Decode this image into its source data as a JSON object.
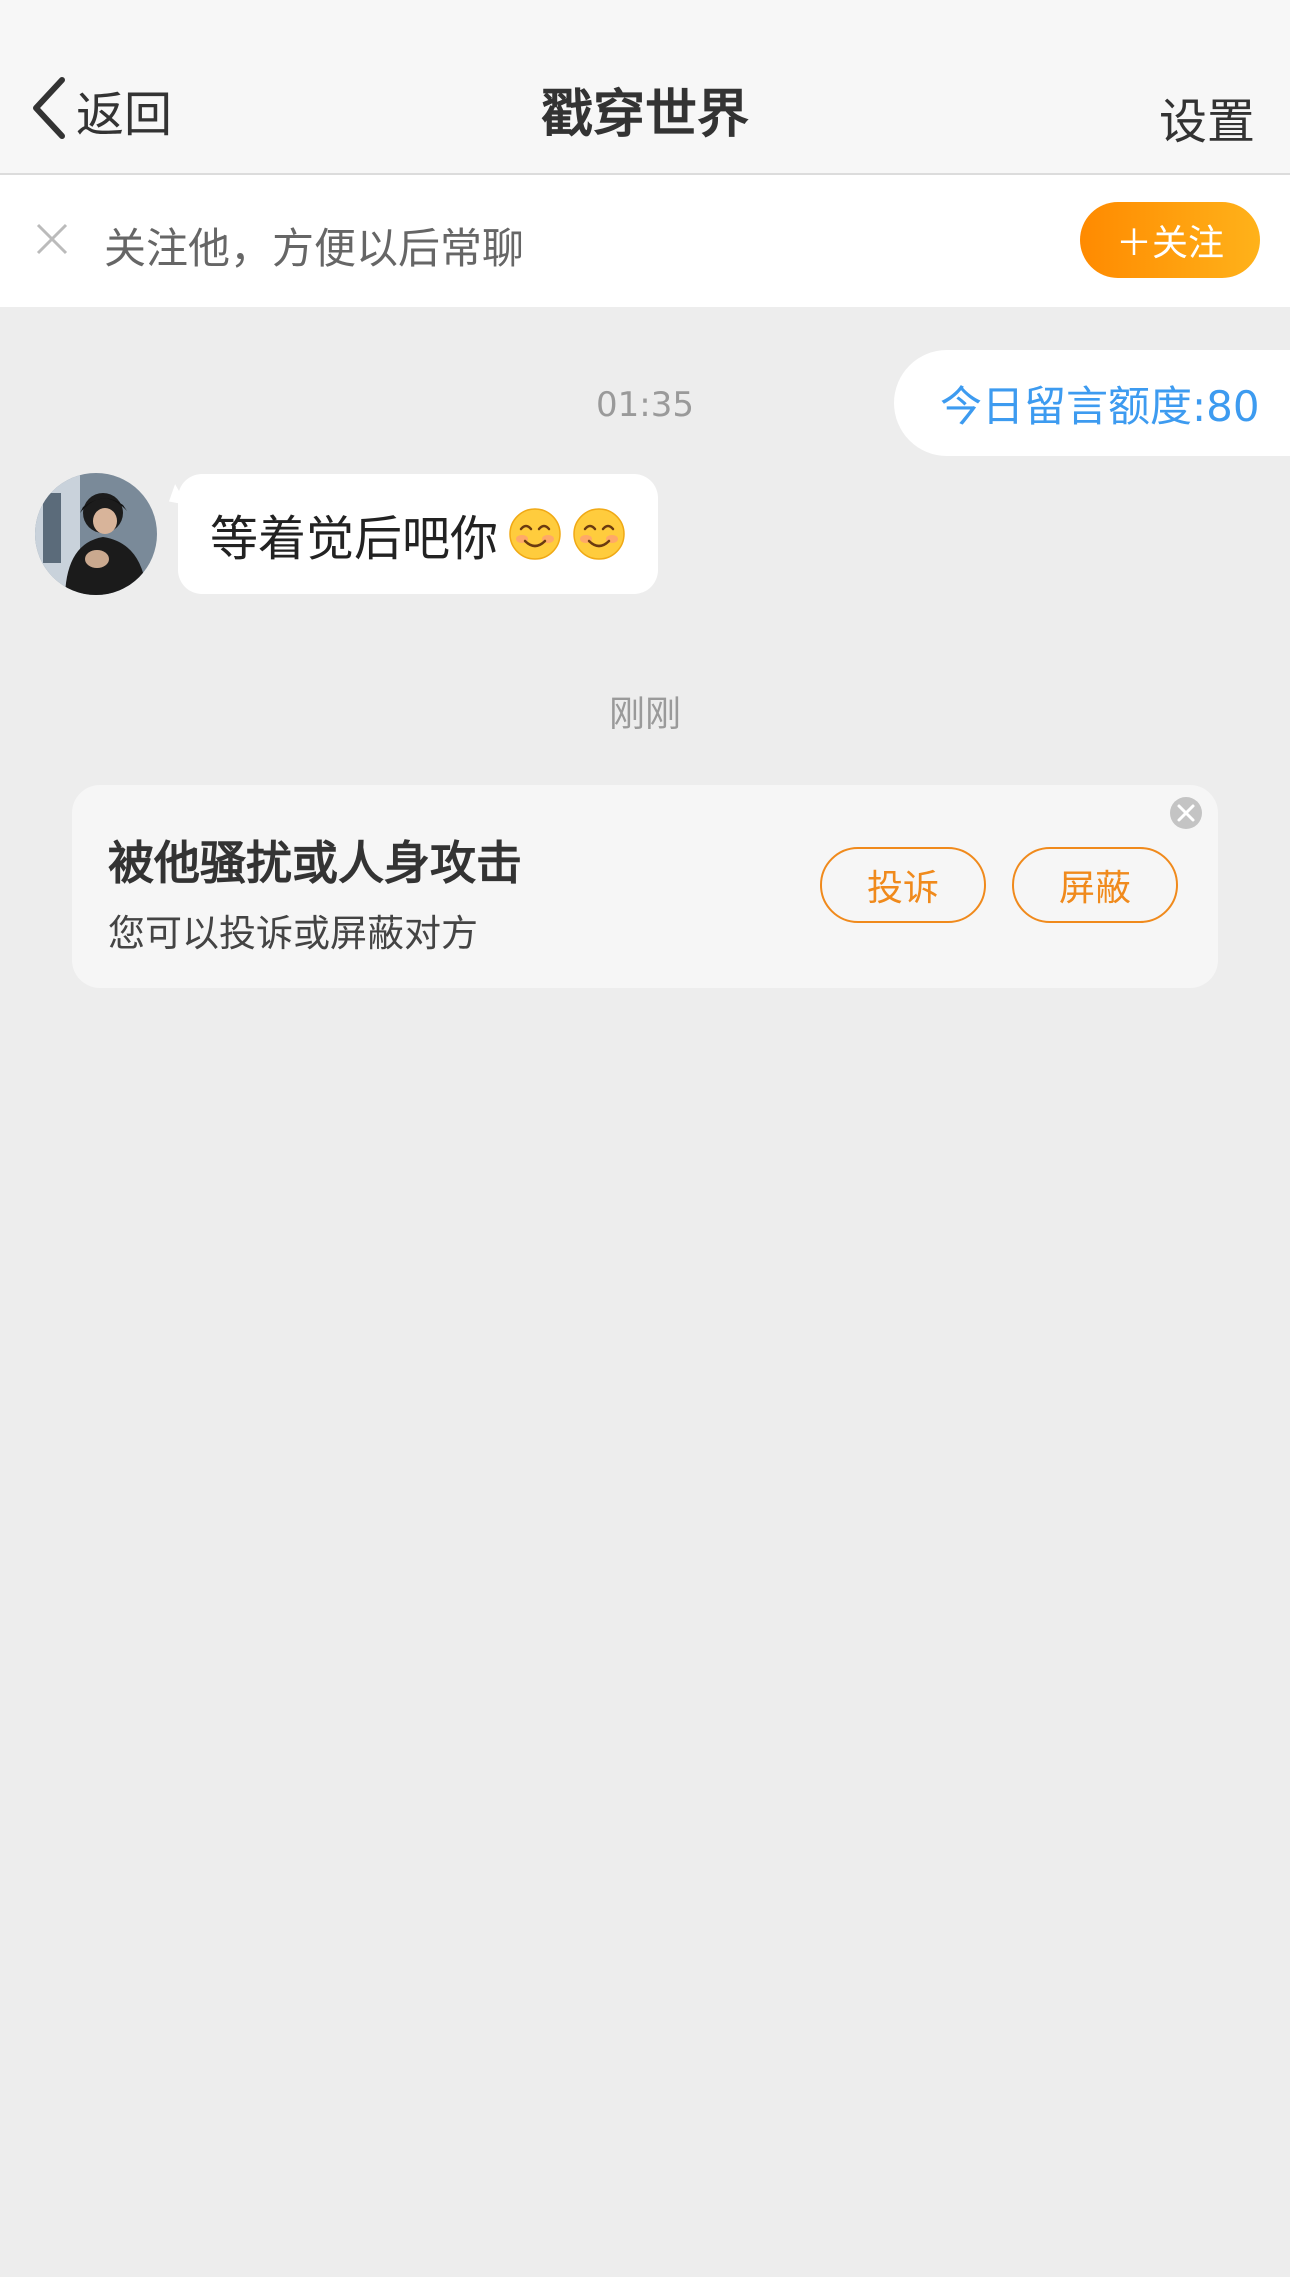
{
  "navbar": {
    "back_label": "返回",
    "title": "戳穿世界",
    "settings_label": "设置"
  },
  "follow_bar": {
    "prompt": "关注他，方便以后常聊",
    "follow_button": "＋关注",
    "accent_color": "#ff8a00"
  },
  "quota": {
    "text": "今日留言额度:80",
    "color": "#3d9bf0"
  },
  "messages": [
    {
      "timestamp": "01:35",
      "text": "等着觉后吧你",
      "emojis": [
        "smiling-face-icon",
        "smiling-face-icon"
      ]
    }
  ],
  "notice": {
    "timestamp": "刚刚",
    "title": "被他骚扰或人身攻击",
    "subtitle": "您可以投诉或屏蔽对方",
    "complain_button": "投诉",
    "block_button": "屏蔽",
    "accent_color": "#f08a1c"
  }
}
